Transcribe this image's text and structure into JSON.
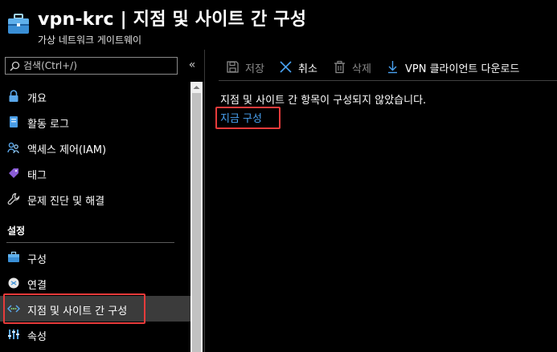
{
  "header": {
    "title": "vpn-krc | 지점 및 사이트 간 구성",
    "subtitle": "가상 네트워크 게이트웨이",
    "icon": "vpn-gateway-briefcase-icon"
  },
  "sidebar": {
    "search_placeholder": "검색(Ctrl+/)",
    "collapse_label": "«",
    "items": [
      {
        "label": "개요",
        "icon": "lock-icon"
      },
      {
        "label": "활동 로그",
        "icon": "log-icon"
      },
      {
        "label": "액세스 제어(IAM)",
        "icon": "people-icon"
      },
      {
        "label": "태그",
        "icon": "tag-icon"
      },
      {
        "label": "문제 진단 및 해결",
        "icon": "wrench-icon"
      }
    ],
    "section_label": "설정",
    "settings_items": [
      {
        "label": "구성",
        "icon": "briefcase-icon"
      },
      {
        "label": "연결",
        "icon": "connection-icon"
      },
      {
        "label": "지점 및 사이트 간 구성",
        "icon": "point-to-site-icon",
        "selected": true
      },
      {
        "label": "속성",
        "icon": "properties-sliders-icon"
      }
    ]
  },
  "toolbar": {
    "save_label": "저장",
    "cancel_label": "취소",
    "delete_label": "삭제",
    "download_label": "VPN 클라이언트 다운로드"
  },
  "main": {
    "message": "지점 및 사이트 간 항목이 구성되지 않았습니다.",
    "configure_link": "지금 구성"
  },
  "colors": {
    "background": "#000000",
    "selected_bg": "#3b3b3b",
    "link": "#4aa3f3",
    "highlight": "#e63b3b",
    "disabled_text": "#8a8a8a"
  }
}
